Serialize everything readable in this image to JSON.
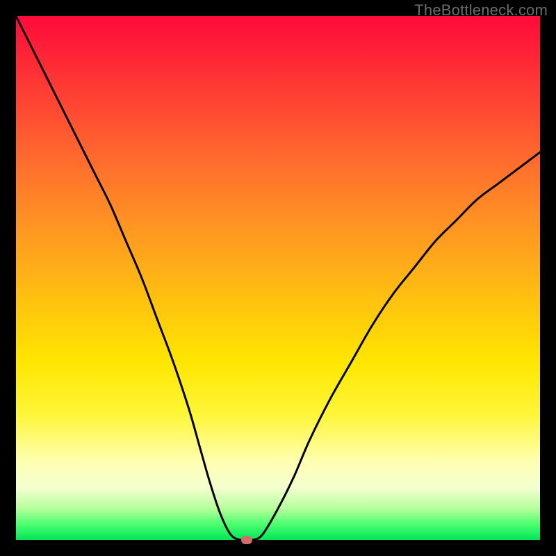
{
  "watermark": "TheBottleneck.com",
  "chart_data": {
    "type": "line",
    "title": "",
    "xlabel": "",
    "ylabel": "",
    "xlim": [
      0,
      100
    ],
    "ylim": [
      0,
      100
    ],
    "x": [
      0,
      3,
      6,
      9,
      12,
      15,
      18,
      21,
      24,
      27,
      30,
      33,
      35,
      37,
      39,
      41,
      43,
      45,
      47,
      50,
      53,
      56,
      60,
      64,
      68,
      72,
      76,
      80,
      84,
      88,
      92,
      96,
      100
    ],
    "y": [
      100,
      94,
      88,
      82,
      76,
      70,
      64,
      57,
      50,
      42,
      34,
      25,
      18,
      11,
      5,
      1,
      0,
      0,
      1,
      6,
      12,
      19,
      27,
      34,
      41,
      47,
      52,
      57,
      61,
      65,
      68,
      71,
      74
    ],
    "marker": {
      "x": 44,
      "y": 0
    },
    "gradient_colors": [
      "#ff0a3a",
      "#ffe600",
      "#00e658"
    ]
  }
}
